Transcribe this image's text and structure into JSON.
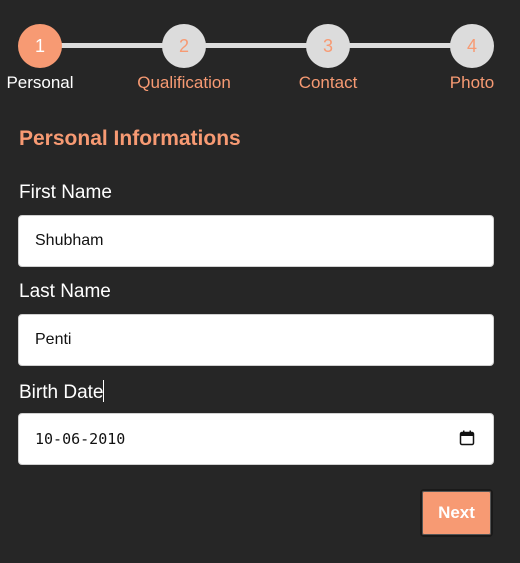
{
  "stepper": {
    "steps": [
      {
        "number": "1",
        "label": "Personal",
        "active": true
      },
      {
        "number": "2",
        "label": "Qualification",
        "active": false
      },
      {
        "number": "3",
        "label": "Contact",
        "active": false
      },
      {
        "number": "4",
        "label": "Photo",
        "active": false
      }
    ]
  },
  "form": {
    "title": "Personal Informations",
    "first_name": {
      "label": "First Name",
      "value": "Shubham"
    },
    "last_name": {
      "label": "Last Name",
      "value": "Penti"
    },
    "birth_date": {
      "label": "Birth Date",
      "value": "10-06-2010",
      "icon": "calendar-icon"
    },
    "next_label": "Next"
  },
  "colors": {
    "accent": "#f79a73",
    "background": "#262626",
    "inactive_step": "#dcdcdc"
  }
}
